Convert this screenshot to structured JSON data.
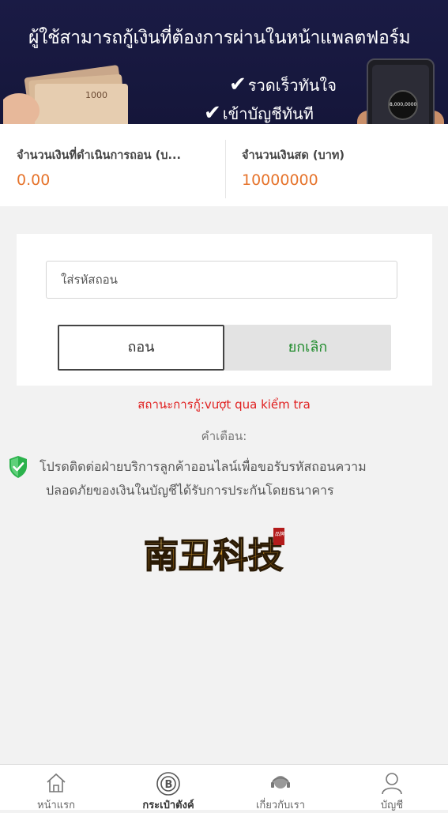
{
  "banner": {
    "title": "ผู้ใช้สามารถกู้เงินที่ต้องการผ่านในหน้าแพลตฟอร์ม",
    "bullet1": "รวดเร็วทันใจ",
    "bullet2": "เข้าบัญชีทันที",
    "check_glyph": "✔",
    "money_label": "1000",
    "phone_amount": "8,000,0000"
  },
  "amounts": {
    "withdrawing_label": "จำนวนเงินที่ดำเนินการถอน (บ...",
    "withdrawing_value": "0.00",
    "cash_label": "จำนวนเงินสด (บาท)",
    "cash_value": "10000000"
  },
  "form": {
    "code_placeholder": "ใส่รหัสถอน",
    "withdraw_label": "ถอน",
    "cancel_label": "ยกเลิก"
  },
  "status_text": "สถานะการกู้:vượt qua kiểm tra",
  "warning": {
    "title": "คำเตือน:",
    "line1": "โปรดติดต่อฝ่ายบริการลูกค้าออนไลน์เพื่อขอรับรหัสถอนความ",
    "line2": "ปลอดภัยของเงินในบัญชีได้รับการประกันโดยธนาคาร"
  },
  "logo": {
    "text": "南丑科技",
    "seal": "品牌"
  },
  "nav": [
    {
      "label": "หน้าแรก",
      "icon": "home-icon"
    },
    {
      "label": "กระเป๋าตังค์",
      "icon": "wallet-coin-icon"
    },
    {
      "label": "เกี่ยวกับเรา",
      "icon": "support-agent-icon"
    },
    {
      "label": "บัญชี",
      "icon": "user-icon"
    }
  ],
  "colors": {
    "accent": "#e6742c",
    "status_red": "#e02020",
    "cancel_green": "#1d8a2a",
    "banner_bg": "#1a1b45"
  }
}
